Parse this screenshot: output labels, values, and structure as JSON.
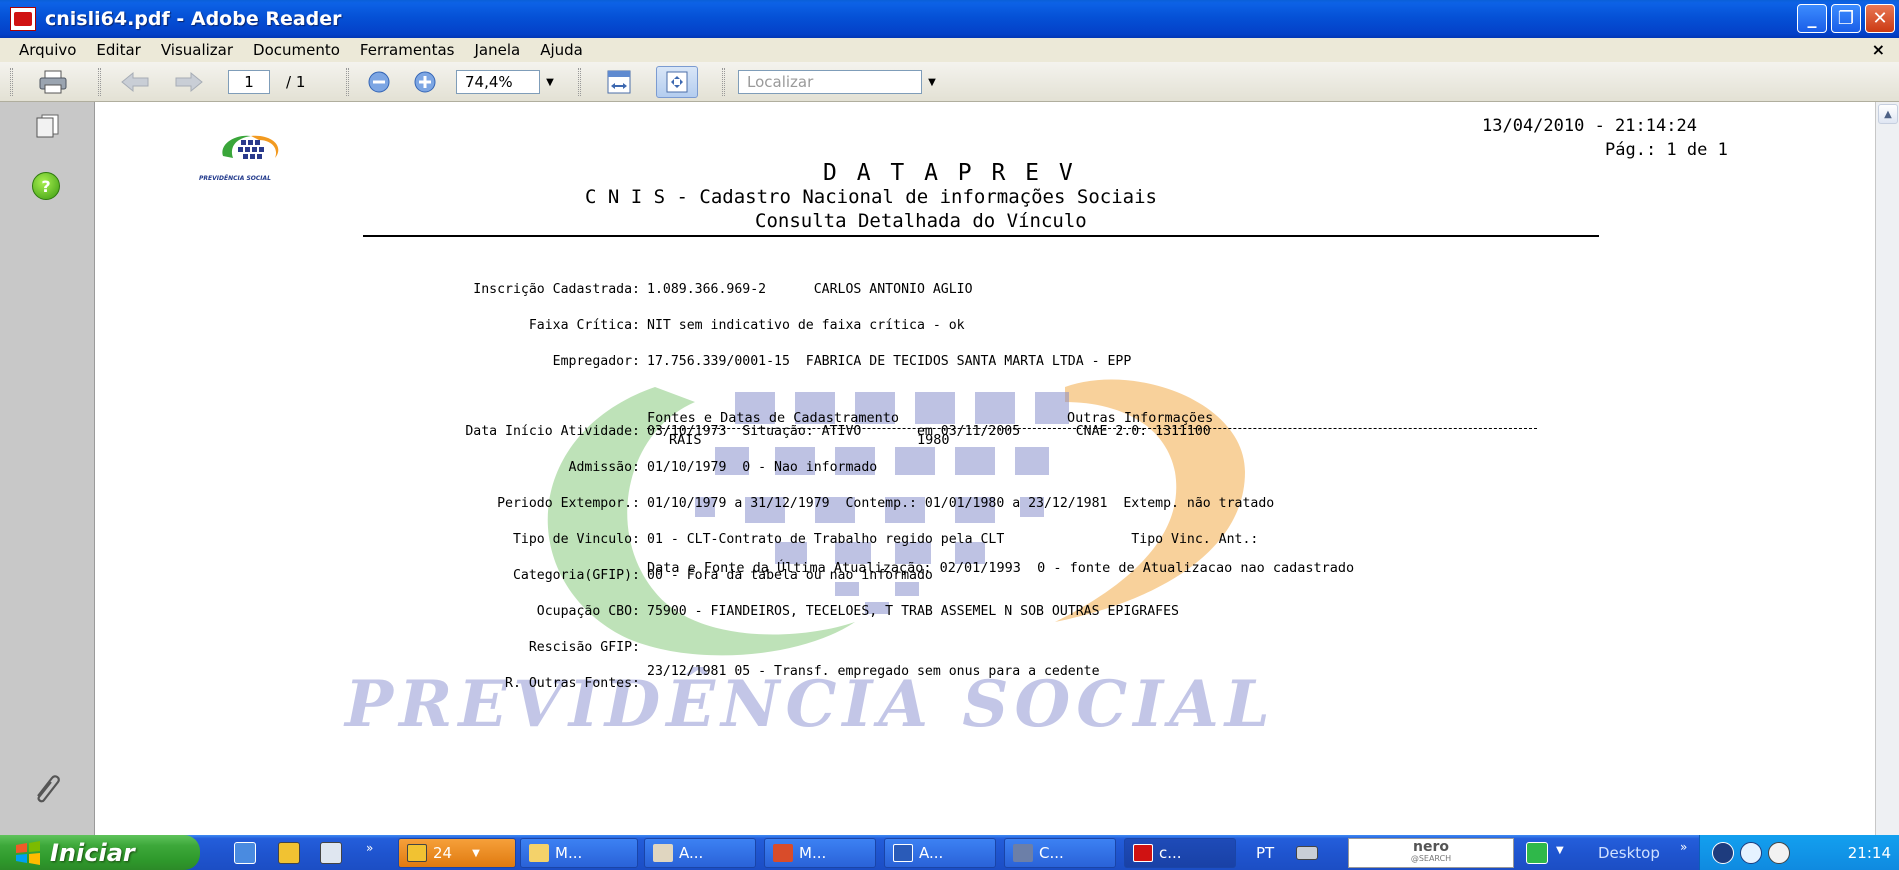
{
  "window": {
    "title": "cnisli64.pdf - Adobe Reader",
    "buttons": [
      "_",
      "❐",
      "✕"
    ]
  },
  "menu": {
    "items": [
      "Arquivo",
      "Editar",
      "Visualizar",
      "Documento",
      "Ferramentas",
      "Janela",
      "Ajuda"
    ],
    "close": "×"
  },
  "toolbar": {
    "page_current": "1",
    "page_total": "/ 1",
    "zoom": "74,4%",
    "search_placeholder": "Localizar"
  },
  "document": {
    "timestamp": "13/04/2010 - 21:14:24",
    "page": "Pág.: 1 de 1",
    "org": "D A T A P R E V",
    "system": "C N I S - Cadastro Nacional de informações Sociais",
    "subtitle": "Consulta Detalhada do Vínculo",
    "logo_caption": "PREVIDÊNCIA SOCIAL",
    "watermark": "PREVIDÊNCIA SOCIAL",
    "fields": [
      {
        "label": "Inscrição Cadastrada:",
        "value": "1.089.366.969-2      CARLOS ANTONIO AGLIO"
      },
      {
        "label": "Faixa Crítica:",
        "value": "NIT sem indicativo de faixa crítica - ok"
      },
      {
        "label": "Empregador:",
        "value": "17.756.339/0001-15  FABRICA DE TECIDOS SANTA MARTA LTDA - EPP"
      },
      {
        "label": "Data Início Atividade:",
        "value": "03/10/1973  Situação: ATIVO       em 03/11/2005       CNAE 2.0: 1311100"
      },
      {
        "label": "Admissão:",
        "value": "01/10/1979  0 - Nao informado"
      },
      {
        "label": "Periodo Extempor.:",
        "value": "01/10/1979 a 31/12/1979  Contemp.: 01/01/1980 a 23/12/1981  Extemp. não tratado"
      },
      {
        "label": "Tipo de Vinculo:",
        "value": "01 - CLT-Contrato de Trabalho regido pela CLT                Tipo Vinc. Ant.:"
      },
      {
        "label": "Categoria(GFIP):",
        "value": "00 - Fora da tabela ou nao informado"
      },
      {
        "label": "Ocupação CBO:",
        "value": "75900 - FIANDEIROS, TECELOES, T TRAB ASSEMEL N SOB OUTRAS EPIGRAFES"
      },
      {
        "label": "Rescisão GFIP:",
        "value": ""
      },
      {
        "label": "R. Outras Fontes:",
        "value": "23/12/1981 05 - Transf. empregado sem onus para a cedente"
      }
    ],
    "sources_header": "Fontes e Datas de Cadastramento",
    "other_header": "Outras Informações",
    "source_name": "RAIS",
    "source_year": "1980",
    "last_update": "Data e Fonte da Última Atualização: 02/01/1993  0 - fonte de Atualizacao nao cadastrado"
  },
  "taskbar": {
    "start": "Iniciar",
    "tasks": [
      "24",
      "M...",
      "A...",
      "M...",
      "A...",
      "C...",
      "c..."
    ],
    "lang": "PT",
    "nero": "nero",
    "nero_sub": "@SEARCH",
    "desktop": "Desktop",
    "clock": "21:14"
  },
  "colors": {
    "title_blue": "#0551d6",
    "green_swoosh": "#a8d8a0",
    "orange_swoosh": "#f6c17a",
    "blue_blocks": "#7f86c8"
  }
}
